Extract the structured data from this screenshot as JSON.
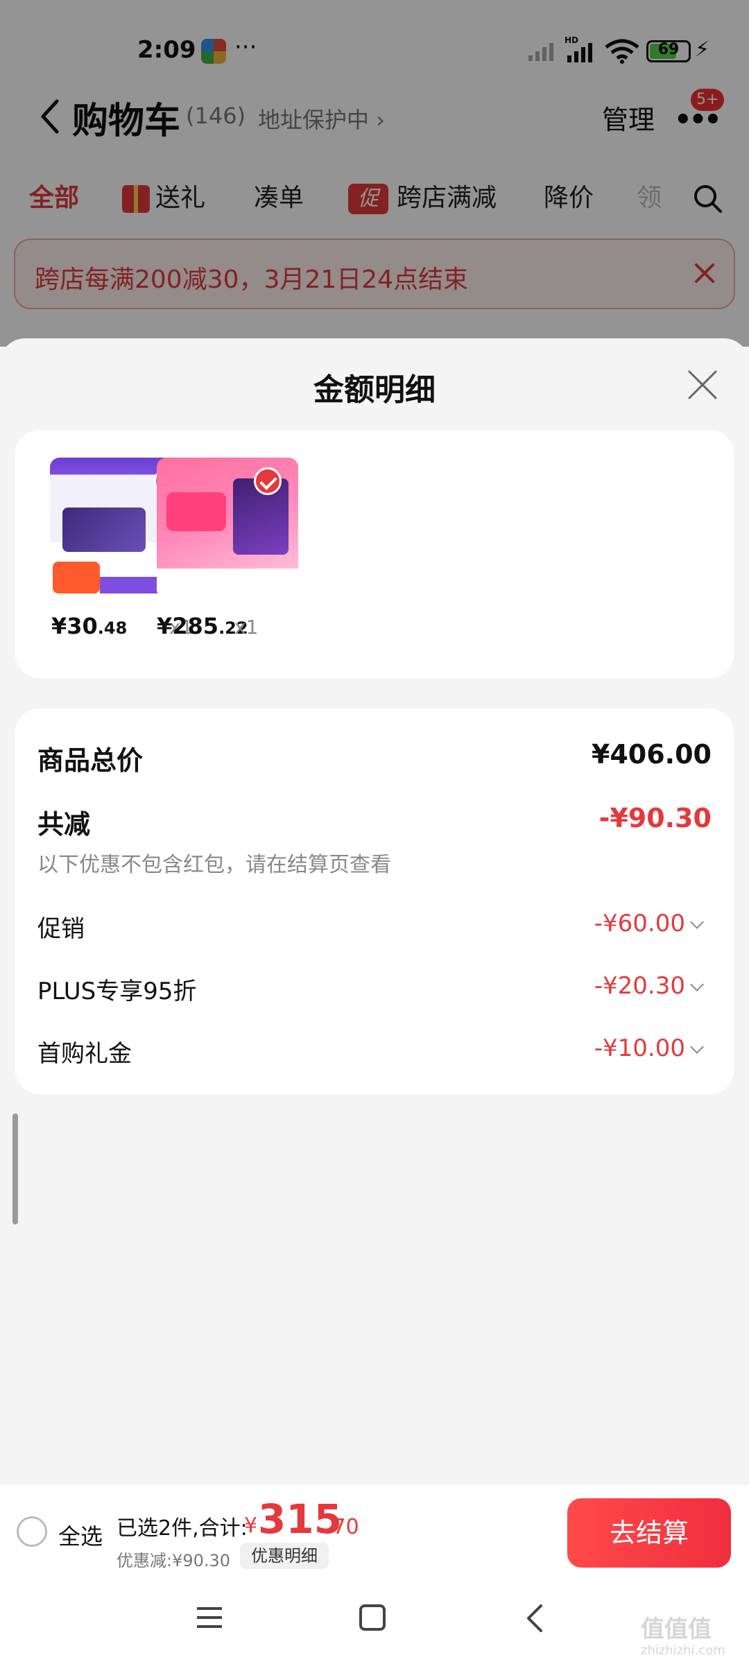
{
  "status_bar": {
    "time": "2:09",
    "dots": "···",
    "battery": "69"
  },
  "nav": {
    "title": "购物车",
    "count": "(146)",
    "address": "地址保护中 ›",
    "manage": "管理",
    "more": "•••",
    "badge": "5+"
  },
  "filters": {
    "all": "全部",
    "gift": "送礼",
    "bundle": "凑单",
    "promo_icon": "促",
    "cross_store": "跨店满减",
    "price_drop": "降价",
    "cut_off": "领"
  },
  "promo_banner": {
    "text": "跨店每满200减30，3月21日24点结束"
  },
  "sheet": {
    "title": "金额明细",
    "products": [
      {
        "price_int": "¥30",
        "price_dec": ".48",
        "qty": "x1"
      },
      {
        "price_int": "¥285",
        "price_dec": ".22",
        "qty": "x1"
      }
    ],
    "summary": {
      "total_label": "商品总价",
      "total_value": "¥406.00",
      "discount_label": "共减",
      "discount_value": "-¥90.30",
      "note": "以下优惠不包含红包，请在结算页查看",
      "items": [
        {
          "label": "促销",
          "value": "-¥60.00"
        },
        {
          "label": "PLUS专享95折",
          "value": "-¥20.30"
        },
        {
          "label": "首购礼金",
          "value": "-¥10.00"
        }
      ]
    }
  },
  "checkout": {
    "select_all": "全选",
    "selected_info": "已选2件,合计:",
    "currency": "¥",
    "total_int": "315",
    "total_dec": ".70",
    "saved": "优惠减:¥90.30",
    "detail_button": "优惠明细",
    "checkout_button": "去结算"
  },
  "watermark": {
    "main": "值值值",
    "sub": "zhizhizhi.com"
  },
  "colors": {
    "accent": "#e4393c",
    "checkout_gradient_start": "#ff4a4a",
    "checkout_gradient_end": "#f02e3e"
  }
}
